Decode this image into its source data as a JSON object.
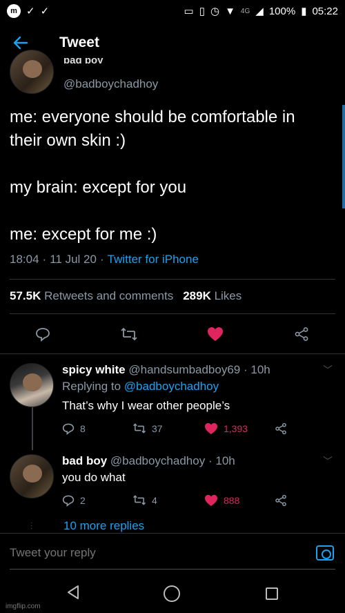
{
  "status_bar": {
    "network": "4G",
    "battery": "100%",
    "time": "05:22"
  },
  "header": {
    "title": "Tweet"
  },
  "tweet": {
    "author_name_partial": "bad boy",
    "author_handle": "@badboychadhoy",
    "lines": [
      "me: everyone should be comfortable in their own skin :)",
      "my brain: except for you",
      "me: except for me :)"
    ],
    "time": "18:04",
    "date": "11 Jul 20",
    "source": "Twitter for iPhone",
    "retweets_count": "57.5K",
    "retweets_label": "Retweets and comments",
    "likes_count": "289K",
    "likes_label": "Likes"
  },
  "replies": [
    {
      "name": "spicy white",
      "handle": "@handsumbadboy69",
      "age": "10h",
      "replying_to_label": "Replying to",
      "replying_to_handle": "@badboychadhoy",
      "text": "That’s why I wear other people’s",
      "replies": "8",
      "retweets": "37",
      "likes": "1,393"
    },
    {
      "name": "bad boy",
      "handle": "@badboychadhoy",
      "age": "10h",
      "text": "you do what",
      "replies": "2",
      "retweets": "4",
      "likes": "888"
    }
  ],
  "more_replies": "10 more replies",
  "composer": {
    "placeholder": "Tweet your reply"
  },
  "watermark": "imgflip.com",
  "colors": {
    "accent": "#1da1f2",
    "like": "#e0245e",
    "muted": "#8b98a5"
  }
}
